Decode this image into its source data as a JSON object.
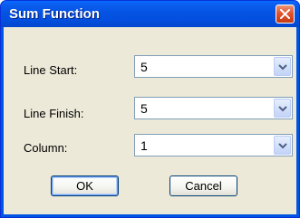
{
  "dialog": {
    "title": "Sum Function",
    "close_icon": "close-icon"
  },
  "fields": {
    "line_start": {
      "label": "Line Start:",
      "value": "5"
    },
    "line_finish": {
      "label": "Line Finish:",
      "value": "5"
    },
    "column": {
      "label": "Column:",
      "value": "1"
    }
  },
  "buttons": {
    "ok": "OK",
    "cancel": "Cancel"
  },
  "colors": {
    "titlebar": "#0054e3",
    "client": "#ece9d8",
    "close": "#e2532e"
  }
}
